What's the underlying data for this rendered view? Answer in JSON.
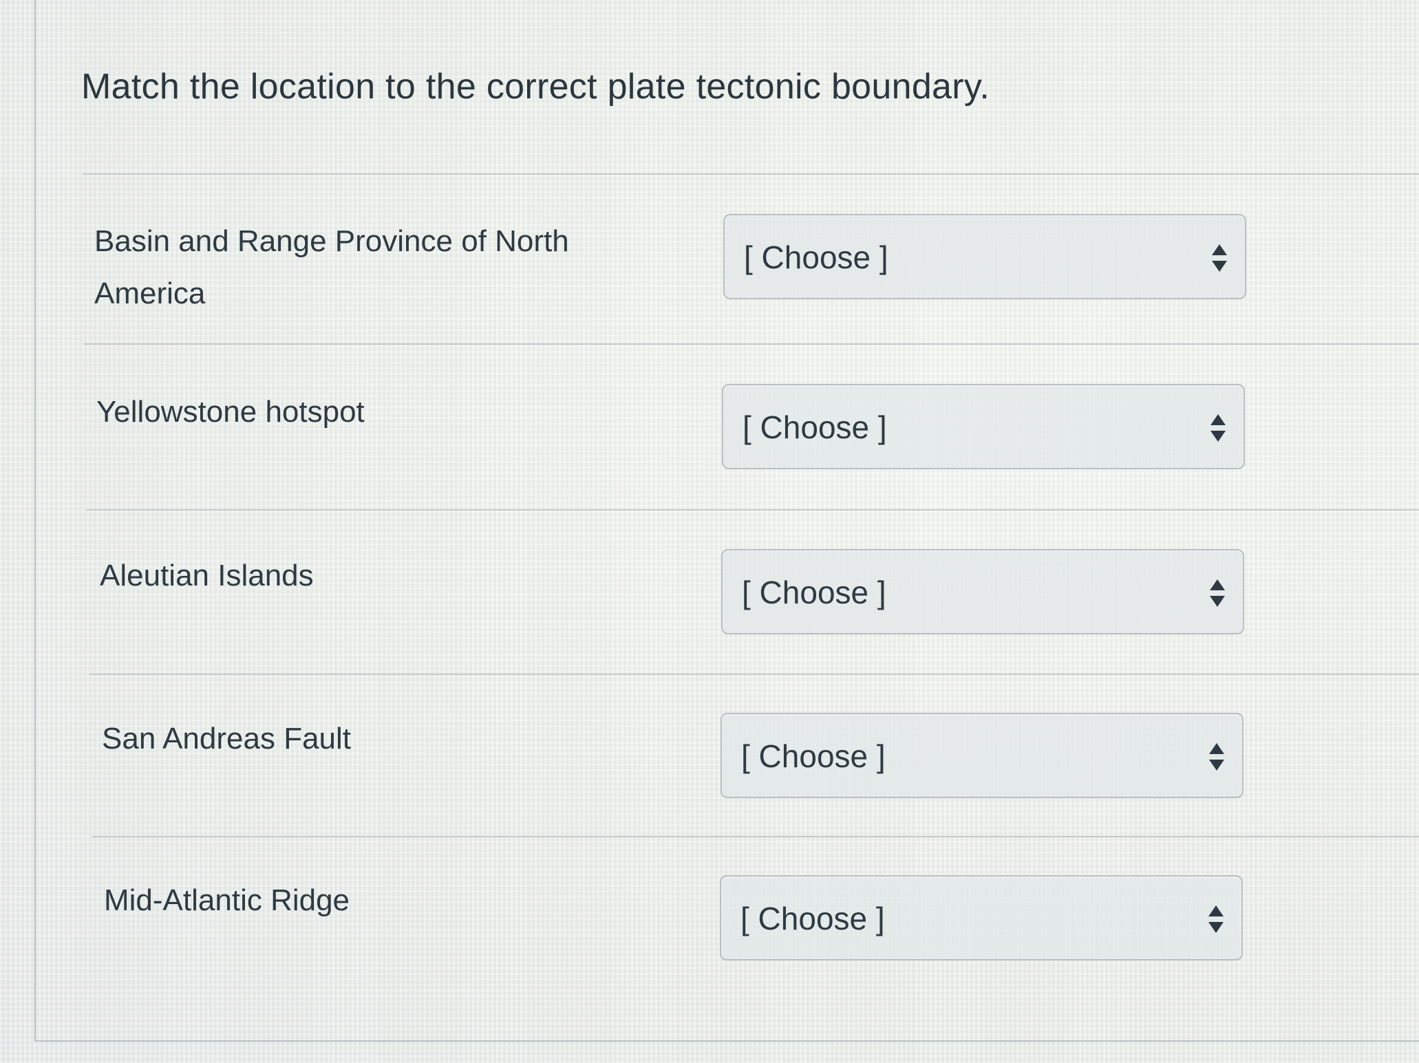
{
  "question": {
    "text": "Match the location to the correct plate tectonic boundary."
  },
  "rows": [
    {
      "label": "Basin and Range Province of North America",
      "select_value": "[ Choose ]"
    },
    {
      "label": "Yellowstone hotspot",
      "select_value": "[ Choose ]"
    },
    {
      "label": "Aleutian Islands",
      "select_value": "[ Choose ]"
    },
    {
      "label": "San Andreas Fault",
      "select_value": "[ Choose ]"
    },
    {
      "label": "Mid-Atlantic Ridge",
      "select_value": "[ Choose ]"
    }
  ],
  "icons": {
    "select_arrow": "up-down-arrows-icon"
  },
  "colors": {
    "text": "#2e3a42",
    "divider": "#c4cacc",
    "select_border": "#b8bfc3"
  }
}
